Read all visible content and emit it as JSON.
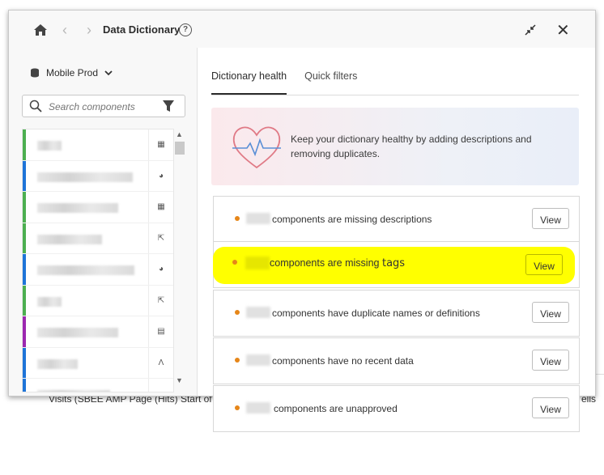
{
  "background": {
    "partial_text": "Visits (SBEE AMP Page (Hits) Start of Se",
    "partial_text_right": "ells"
  },
  "header": {
    "title": "Data Dictionary",
    "help": "?",
    "back": "‹",
    "forward": "›",
    "close": "✕"
  },
  "sidebar": {
    "data_view": "Mobile Prod",
    "search_placeholder": "Search components",
    "rows": [
      {
        "color": "#4caf50",
        "icon": "calculator-icon",
        "glyph": "▦"
      },
      {
        "color": "#1e74d8",
        "icon": "segment-icon",
        "glyph": "◕"
      },
      {
        "color": "#4caf50",
        "icon": "calculator-icon",
        "glyph": "▦"
      },
      {
        "color": "#4caf50",
        "icon": "cursor-icon",
        "glyph": "⇱"
      },
      {
        "color": "#1e74d8",
        "icon": "segment-icon",
        "glyph": "◕"
      },
      {
        "color": "#4caf50",
        "icon": "cursor-icon",
        "glyph": "⇱"
      },
      {
        "color": "#9c27b0",
        "icon": "calendar-icon",
        "glyph": "▤"
      },
      {
        "color": "#1e74d8",
        "icon": "adobe-icon",
        "glyph": "Ʌ"
      },
      {
        "color": "#1e74d8",
        "icon": "segment-icon",
        "glyph": "◕"
      }
    ]
  },
  "tabs": [
    {
      "label": "Dictionary health",
      "active": true
    },
    {
      "label": "Quick filters",
      "active": false
    }
  ],
  "banner": {
    "text": "Keep your dictionary healthy by adding descriptions and removing duplicates."
  },
  "health_items": [
    {
      "text": "components are missing descriptions",
      "action": "View"
    },
    {
      "text": "components are missing",
      "emphasis": "tags",
      "action": "View"
    },
    {
      "text": "components have duplicate names or definitions",
      "action": "View"
    },
    {
      "text": "components have no recent data",
      "action": "View"
    },
    {
      "text": "components are unapproved",
      "action": "View"
    }
  ],
  "colors": {
    "status_dot": "#e68619",
    "highlight": "#ffff00"
  }
}
